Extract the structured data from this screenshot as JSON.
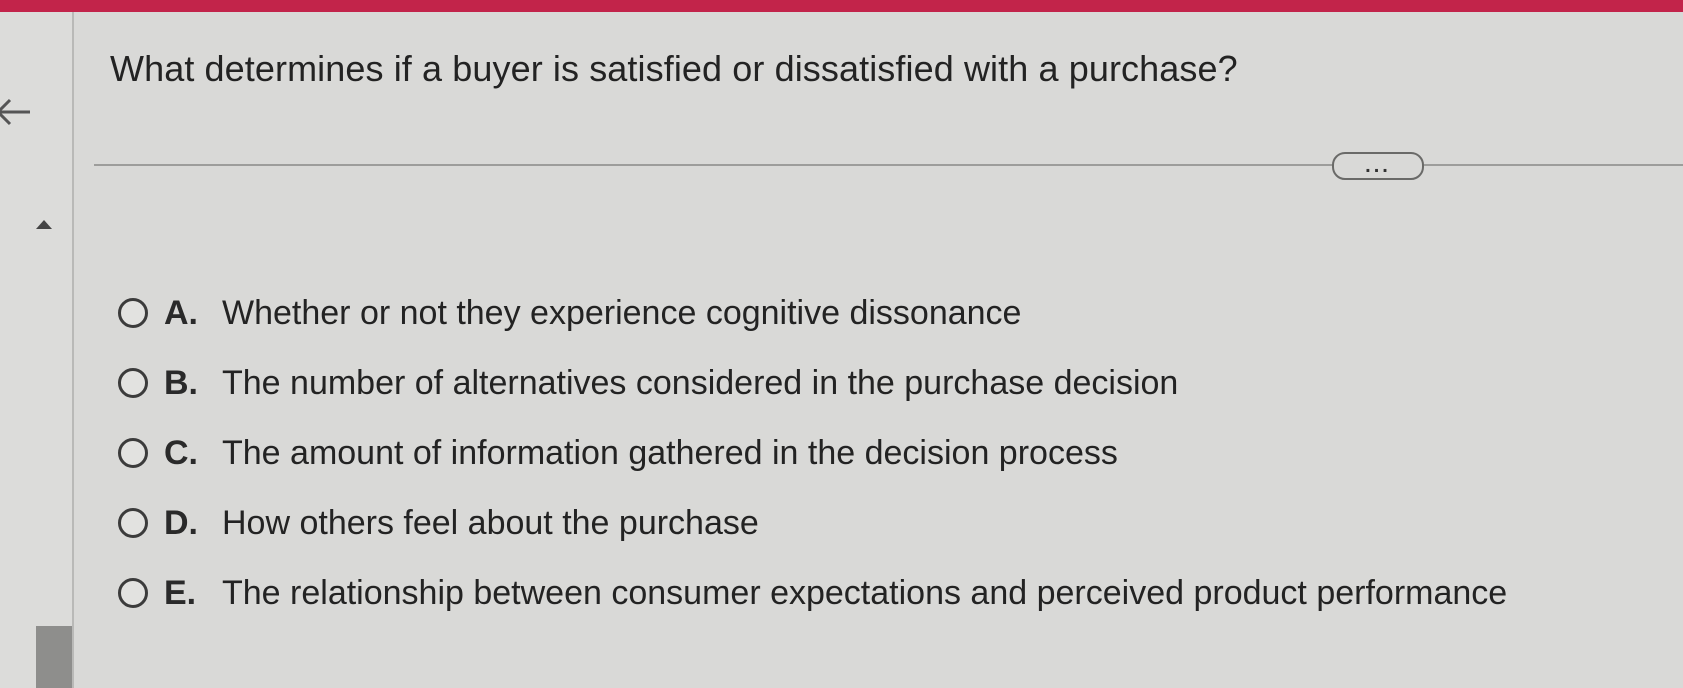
{
  "question": {
    "text": "What determines if a buyer is satisfied or dissatisfied with a purchase?"
  },
  "toolbar": {
    "more_label": "..."
  },
  "options": [
    {
      "letter": "A.",
      "text": "Whether or not they experience cognitive dissonance",
      "selected": false
    },
    {
      "letter": "B.",
      "text": "The number of alternatives considered in the purchase decision",
      "selected": false
    },
    {
      "letter": "C.",
      "text": "The amount of information gathered in the decision process",
      "selected": false
    },
    {
      "letter": "D.",
      "text": "How others feel about the purchase",
      "selected": false
    },
    {
      "letter": "E.",
      "text": "The relationship between consumer expectations and perceived product performance",
      "selected": false
    }
  ],
  "icons": {
    "back": "back-arrow-icon",
    "collapse": "caret-up-icon"
  },
  "colors": {
    "top_strip": "#c2244a",
    "background": "#d9d9d7"
  }
}
